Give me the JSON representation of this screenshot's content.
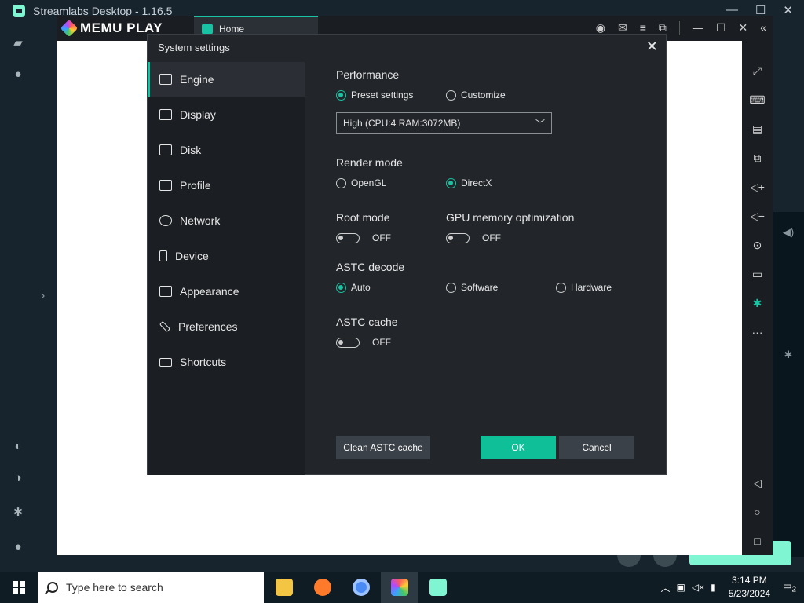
{
  "streamlabs": {
    "title": "Streamlabs Desktop - 1.16.5",
    "window_buttons": [
      "—",
      "☐",
      "✕"
    ]
  },
  "memu": {
    "brand": "MEMU PLAY",
    "tab_home": "Home"
  },
  "dialog": {
    "title": "System settings",
    "nav": [
      {
        "label": "Engine",
        "active": true
      },
      {
        "label": "Display"
      },
      {
        "label": "Disk"
      },
      {
        "label": "Profile"
      },
      {
        "label": "Network"
      },
      {
        "label": "Device"
      },
      {
        "label": "Appearance"
      },
      {
        "label": "Preferences"
      },
      {
        "label": "Shortcuts"
      }
    ],
    "performance": {
      "heading": "Performance",
      "preset_label": "Preset settings",
      "customize_label": "Customize",
      "selected": "preset",
      "dropdown_value": "High (CPU:4 RAM:3072MB)"
    },
    "render_mode": {
      "heading": "Render mode",
      "opengl_label": "OpenGL",
      "directx_label": "DirectX",
      "selected": "DirectX"
    },
    "root_mode": {
      "heading": "Root mode",
      "state": "OFF"
    },
    "gpu_opt": {
      "heading": "GPU memory optimization",
      "state": "OFF"
    },
    "astc_decode": {
      "heading": "ASTC decode",
      "auto_label": "Auto",
      "software_label": "Software",
      "hardware_label": "Hardware",
      "selected": "Auto"
    },
    "astc_cache": {
      "heading": "ASTC cache",
      "state": "OFF"
    },
    "buttons": {
      "clean": "Clean ASTC cache",
      "ok": "OK",
      "cancel": "Cancel"
    }
  },
  "taskbar": {
    "search_placeholder": "Type here to search",
    "time": "3:14 PM",
    "date": "5/23/2024",
    "notification_count": "2"
  },
  "colors": {
    "accent": "#17c3a2",
    "ok_button": "#0fbf98",
    "streamlabs_green": "#80f5d2"
  }
}
